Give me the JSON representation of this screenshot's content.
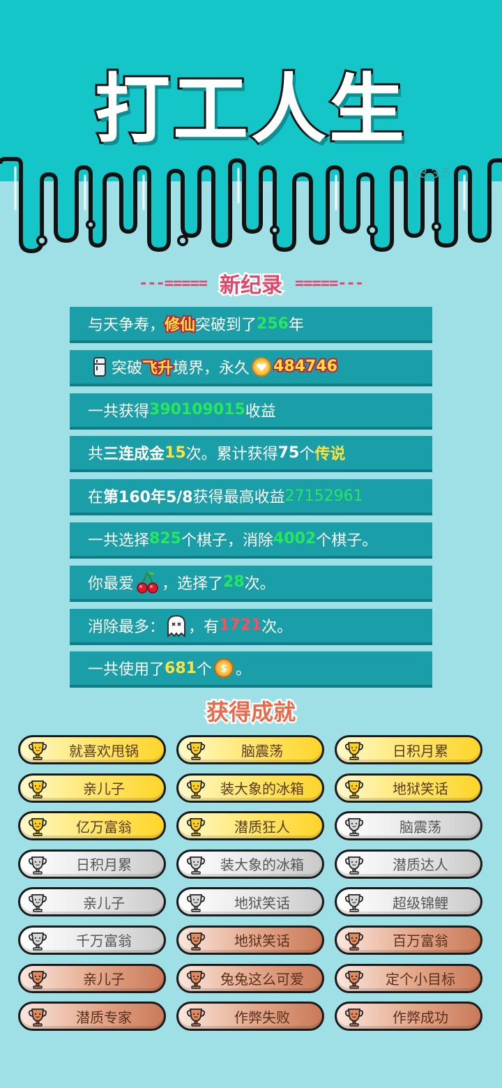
{
  "header": {
    "title": "打工人生",
    "version": "v3.3.5"
  },
  "colors": {
    "teal": "#15c6c9",
    "background": "#9fe0e6",
    "stat_row": "#1a9ea7",
    "highlight_green": "#27e85c",
    "highlight_yellow": "#ffe23d",
    "highlight_red": "#ff4d5e",
    "record_title": "#e0476a"
  },
  "record": {
    "dash_left": "---=====",
    "label": "新纪录",
    "dash_right": "=====---"
  },
  "stats": {
    "s1": {
      "a": "与天争寿，",
      "hl": "修仙",
      "b": "突破到了",
      "num": "256",
      "c": "年"
    },
    "s2": {
      "icon": "fridge-icon",
      "a": "突破",
      "hl": "飞升",
      "b": "境界，永久",
      "coin_icon": "heart-coin-icon",
      "num": "484746"
    },
    "s3": {
      "a": "一共获得",
      "num": "390109015",
      "b": "收益"
    },
    "s4": {
      "a": "共",
      "bold": "三连成金",
      "num": "15",
      "b": "次。累计获得",
      "num2": "75",
      "c": "个",
      "legend": "传说"
    },
    "s5": {
      "a": "在 ",
      "bold": "第160年5/8",
      "b": " 获得最高收益",
      "num": "27152961"
    },
    "s6": {
      "a": "一共选择",
      "num": "825",
      "b": "个棋子，消除",
      "num2": "4002",
      "c": "个棋子。"
    },
    "s7": {
      "a": "你最爱",
      "icon": "cherry-icon",
      "b": "，选择了",
      "num": "28",
      "c": "次。"
    },
    "s8": {
      "a": "消除最多：",
      "icon": "ghost-icon",
      "b": "，有",
      "num": "1721",
      "c": "次。"
    },
    "s9": {
      "a": "一共使用了",
      "num": "681",
      "b": "个",
      "icon": "dollar-coin-icon",
      "c": "。"
    }
  },
  "achievements_title": "获得成就",
  "achievements": [
    {
      "label": "就喜欢甩锅",
      "tier": "gold"
    },
    {
      "label": "脑震荡",
      "tier": "gold"
    },
    {
      "label": "日积月累",
      "tier": "gold"
    },
    {
      "label": "亲儿子",
      "tier": "gold"
    },
    {
      "label": "装大象的冰箱",
      "tier": "gold"
    },
    {
      "label": "地狱笑话",
      "tier": "gold"
    },
    {
      "label": "亿万富翁",
      "tier": "gold"
    },
    {
      "label": "潜质狂人",
      "tier": "gold"
    },
    {
      "label": "脑震荡",
      "tier": "silver"
    },
    {
      "label": "日积月累",
      "tier": "silver"
    },
    {
      "label": "装大象的冰箱",
      "tier": "silver"
    },
    {
      "label": "潜质达人",
      "tier": "silver"
    },
    {
      "label": "亲儿子",
      "tier": "silver"
    },
    {
      "label": "地狱笑话",
      "tier": "silver"
    },
    {
      "label": "超级锦鲤",
      "tier": "silver"
    },
    {
      "label": "千万富翁",
      "tier": "silver"
    },
    {
      "label": "地狱笑话",
      "tier": "bronze"
    },
    {
      "label": "百万富翁",
      "tier": "bronze"
    },
    {
      "label": "亲儿子",
      "tier": "bronze"
    },
    {
      "label": "兔兔这么可爱",
      "tier": "bronze"
    },
    {
      "label": "定个小目标",
      "tier": "bronze"
    },
    {
      "label": "潜质专家",
      "tier": "bronze"
    },
    {
      "label": "作弊失败",
      "tier": "bronze"
    },
    {
      "label": "作弊成功",
      "tier": "bronze"
    }
  ]
}
